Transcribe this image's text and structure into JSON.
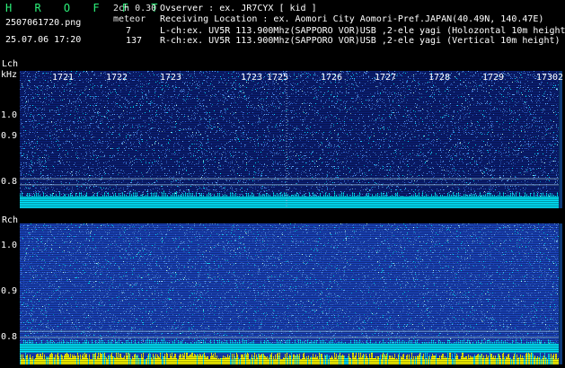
{
  "header": {
    "title": "H R O F F T",
    "version": "2ch 0.30",
    "filename": "2507061720.png",
    "meteor_label": "meteor",
    "timestamp": "25.07.06 17:20",
    "lch_count": "7",
    "rch_count": "137",
    "observer": "Ovserver              : ex. JR7CYX [ kid ]",
    "location": "Receiving Location : ex. Aomori City Aomori-Pref.JAPAN(40.49N, 140.47E)",
    "lch_info": "L-ch:ex. UV5R 113.900Mhz(SAPPORO VOR)USB ,2-ele yagi (Holozontal 10m height)",
    "rch_info": "R-ch:ex. UV5R 113.900Mhz(SAPPORO VOR)USB ,2-ele yagi (Vertical 10m height)"
  },
  "axis": {
    "lch_label": "Lch",
    "khz_label": "kHz",
    "rch_label": "Rch",
    "yticks": [
      "1.0",
      "0.9",
      "0.8"
    ],
    "time_labels": [
      "1721",
      "1722",
      "1723",
      "1723",
      "1725",
      "1726",
      "1727",
      "1728",
      "1729",
      "1730",
      "2"
    ]
  },
  "colors": {
    "background": "#000000",
    "title_green": "#2cf27a",
    "lch_base": "#0b1f78",
    "rch_base": "#1a4ac8",
    "noise_cyan": "#00e5ff",
    "noise_yellow": "#ffff00",
    "marker_white": "#ffffff"
  }
}
